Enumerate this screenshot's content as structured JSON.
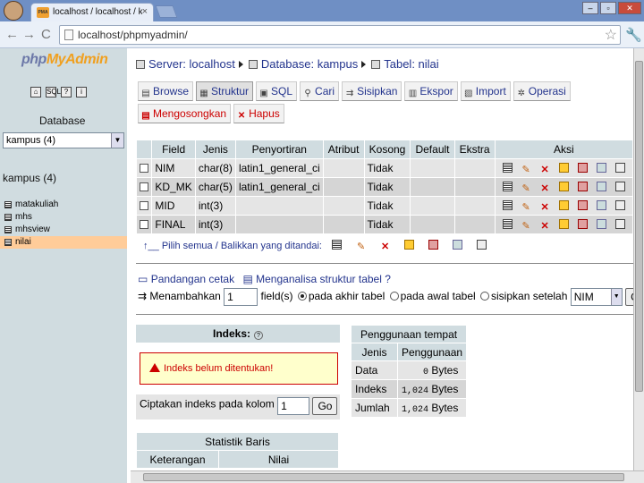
{
  "browser": {
    "tab_title": "localhost / localhost / kampus",
    "tab_close": "×",
    "favicon_label": "PMA",
    "url": "localhost/phpmyadmin/",
    "back": "←",
    "forward": "→",
    "reload": "C",
    "star": "☆",
    "wrench": "🔧",
    "win_min": "–",
    "win_max": "▫",
    "win_close": "✕"
  },
  "sidebar": {
    "logo_php": "php",
    "logo_my": "My",
    "logo_admin": "Admin",
    "database_label": "Database",
    "database_selected": "kampus (4)",
    "db_title": "kampus (4)",
    "tables": [
      {
        "label": "matakuliah"
      },
      {
        "label": "mhs"
      },
      {
        "label": "mhsview"
      },
      {
        "label": "nilai"
      }
    ]
  },
  "breadcrumb": {
    "server": "Server: localhost",
    "database": "Database: kampus",
    "table": "Tabel: nilai"
  },
  "tabs": {
    "browse": "Browse",
    "structure": "Struktur",
    "sql": "SQL",
    "search": "Cari",
    "insert": "Sisipkan",
    "export": "Ekspor",
    "import": "Import",
    "operations": "Operasi",
    "empty": "Mengosongkan",
    "drop": "Hapus"
  },
  "structure": {
    "headers": [
      "Field",
      "Jenis",
      "Penyortiran",
      "Atribut",
      "Kosong",
      "Default",
      "Ekstra",
      "Aksi"
    ],
    "rows": [
      {
        "field": "NIM",
        "type": "char(8)",
        "collation": "latin1_general_ci",
        "attr": "",
        "null": "Tidak",
        "default": "",
        "extra": ""
      },
      {
        "field": "KD_MK",
        "type": "char(5)",
        "collation": "latin1_general_ci",
        "attr": "",
        "null": "Tidak",
        "default": "",
        "extra": ""
      },
      {
        "field": "MID",
        "type": "int(3)",
        "collation": "",
        "attr": "",
        "null": "Tidak",
        "default": "",
        "extra": ""
      },
      {
        "field": "FINAL",
        "type": "int(3)",
        "collation": "",
        "attr": "",
        "null": "Tidak",
        "default": "",
        "extra": ""
      }
    ],
    "check_all": "Pilih semua / Balikkan yang ditandai:"
  },
  "options": {
    "print_view": "Pandangan cetak",
    "analyze": "Menganalisa struktur tabel",
    "add_label": "Menambahkan",
    "add_count": "1",
    "fields_label": "field(s)",
    "at_end": "pada akhir tabel",
    "at_begin": "pada awal tabel",
    "after": "sisipkan setelah",
    "after_field": "NIM",
    "go": "Go"
  },
  "indexes": {
    "title": "Indeks:",
    "help": "?",
    "notice": "Indeks belum ditentukan!",
    "create_label": "Ciptakan indeks pada kolom",
    "create_count": "1",
    "go": "Go"
  },
  "usage": {
    "title": "Penggunaan tempat",
    "col_type": "Jenis",
    "col_usage": "Penggunaan",
    "rows": [
      {
        "label": "Data",
        "value": "0",
        "unit": "Bytes"
      },
      {
        "label": "Indeks",
        "value": "1,024",
        "unit": "Bytes"
      },
      {
        "label": "Jumlah",
        "value": "1,024",
        "unit": "Bytes"
      }
    ]
  },
  "rowstats": {
    "title": "Statistik Baris",
    "col_desc": "Keterangan",
    "col_value": "Nilai"
  }
}
